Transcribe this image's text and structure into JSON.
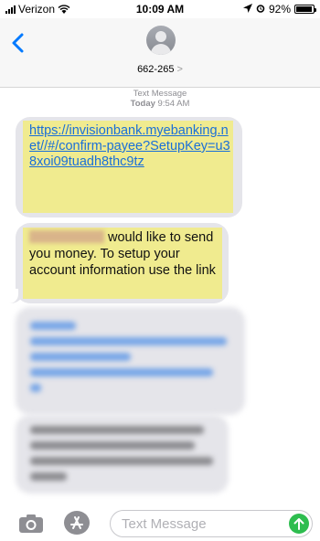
{
  "status": {
    "carrier": "Verizon",
    "time": "10:09 AM",
    "battery": "92%",
    "icons": [
      "signal-bars-icon",
      "wifi-icon",
      "location-arrow-icon",
      "alarm-icon",
      "battery-icon"
    ]
  },
  "header": {
    "contact": "662-265",
    "chevron": ">"
  },
  "thread": {
    "meta_label": "Text Message",
    "meta_day": "Today",
    "meta_time": "9:54 AM",
    "messages": [
      {
        "text": "https://invisionbank.myebanking.net//#/confirm-payee?SetupKey=u38xoi09tuadh8thc9tz"
      },
      {
        "text": "would like to send you money. To setup your account information use the link"
      }
    ]
  },
  "input_bar": {
    "placeholder": "Text Message"
  },
  "colors": {
    "accent": "#007aff",
    "bubble": "#e5e5ea",
    "highlight": "#f0eb8f",
    "send": "#2ebd4f"
  }
}
